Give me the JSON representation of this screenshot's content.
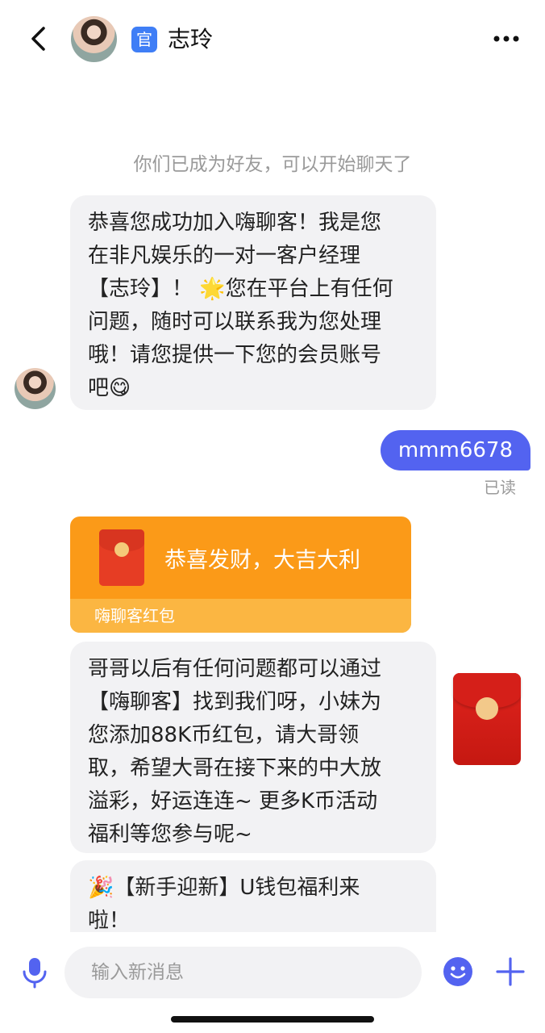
{
  "header": {
    "badge": "官",
    "contact_name": "志玲"
  },
  "chat": {
    "system_tip": "你们已成为好友，可以开始聊天了",
    "msg1_lines": [
      "恭喜您成功加入嗨聊客！我是您",
      "在非凡娱乐的一对一客户经理",
      "【志玲】！ 🌟您在平台上有任何",
      "问题，随时可以联系我为您处理",
      "哦！请您提供一下您的会员账号",
      "吧😋"
    ],
    "reply": "mmm6678",
    "read_status": "已读",
    "red_packet": {
      "greeting": "恭喜发财，大吉大利",
      "source": "嗨聊客红包"
    },
    "msg2_lines": [
      "哥哥以后有任何问题都可以通过",
      "【嗨聊客】找到我们呀，小妹为",
      "您添加88K币红包，请大哥领",
      "取，希望大哥在接下来的中大放",
      "溢彩，好运连连~ 更多K币活动",
      "福利等您参与呢~"
    ],
    "msg3_lines": [
      "🎉【新手迎新】U钱包福利来",
      "啦！"
    ]
  },
  "input": {
    "placeholder": "输入新消息"
  },
  "icons": {
    "back": "back-arrow-icon",
    "more": "more-dots-icon",
    "mic": "microphone-icon",
    "emoji": "emoji-icon",
    "plus": "plus-icon"
  },
  "colors": {
    "accent": "#5363f0",
    "badge": "#3f7ef6",
    "red_packet": "#fb9a18",
    "bubble_gray": "#f2f2f4"
  }
}
